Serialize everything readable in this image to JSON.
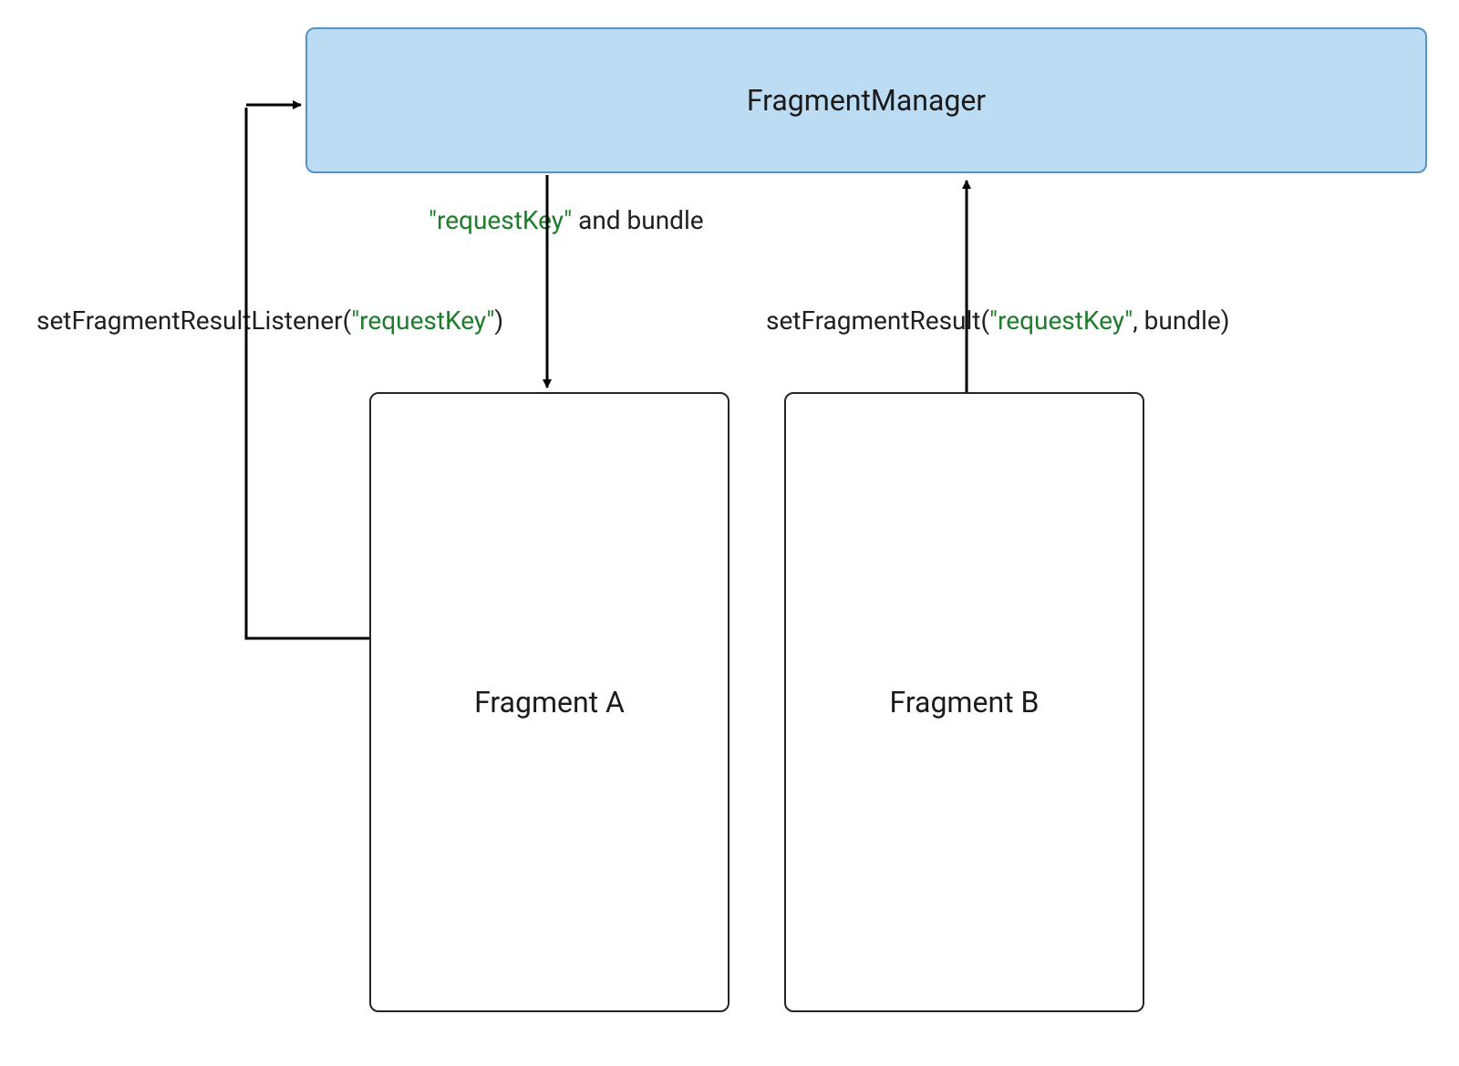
{
  "boxes": {
    "manager": {
      "label": "FragmentManager"
    },
    "fragmentA": {
      "label": "Fragment A"
    },
    "fragmentB": {
      "label": "Fragment B"
    }
  },
  "labels": {
    "listener": {
      "prefix": "setFragmentResultListener(",
      "key": "\"requestKey\"",
      "suffix": ")"
    },
    "deliver": {
      "key": "\"requestKey\"",
      "suffix": " and bundle"
    },
    "setResult": {
      "prefix": "setFragmentResult(",
      "key": "\"requestKey\"",
      "suffix": ", bundle)"
    }
  },
  "colors": {
    "managerFill": "#bcdcf4",
    "managerStroke": "#5493c8",
    "boxStroke": "#252525",
    "text": "#1b1b1b",
    "keyString": "#1e7d2b"
  },
  "diagram": {
    "nodes": [
      {
        "id": "manager",
        "type": "container",
        "label": "FragmentManager"
      },
      {
        "id": "fragmentA",
        "type": "fragment",
        "label": "Fragment A"
      },
      {
        "id": "fragmentB",
        "type": "fragment",
        "label": "Fragment B"
      }
    ],
    "edges": [
      {
        "from": "fragmentA",
        "to": "manager",
        "label": "setFragmentResultListener(\"requestKey\")"
      },
      {
        "from": "manager",
        "to": "fragmentA",
        "label": "\"requestKey\" and bundle"
      },
      {
        "from": "fragmentB",
        "to": "manager",
        "label": "setFragmentResult(\"requestKey\", bundle)"
      }
    ]
  }
}
